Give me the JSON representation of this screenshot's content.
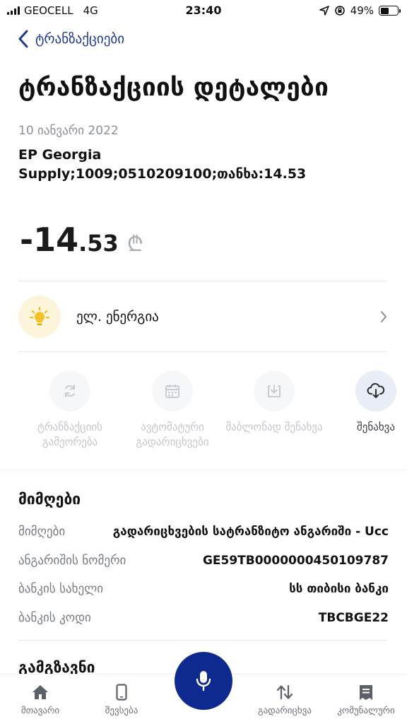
{
  "status_bar": {
    "carrier": "GEOCELL",
    "network": "4G",
    "time": "23:40",
    "battery_percent": "49%",
    "battery_level": 0.49
  },
  "nav": {
    "back_label": "ტრანზაქციები"
  },
  "page_title": "ტრანზაქციის დეტალები",
  "transaction": {
    "date": "10 იანვარი 2022",
    "merchant": "EP Georgia Supply;1009;0510209100;თანხა:14.53",
    "amount_int": "-14",
    "amount_dec": ".53",
    "currency_symbol": "₾"
  },
  "category": {
    "label": "ელ. ენერგია",
    "icon": "lightbulb-icon"
  },
  "actions": [
    {
      "label": "ტრანზაქციის გამეორება",
      "icon": "repeat-icon",
      "enabled": false
    },
    {
      "label": "ავტომატური გადარიცხვები",
      "icon": "calendar-icon",
      "enabled": false
    },
    {
      "label": "შაბლონად შენახვა",
      "icon": "download-template-icon",
      "enabled": false
    },
    {
      "label": "შენახვა",
      "icon": "cloud-download-icon",
      "enabled": true
    }
  ],
  "recipient": {
    "title": "მიმღები",
    "rows": [
      {
        "key": "მიმღები",
        "value": "გადარიცხვების სატრანზიტო ანგარიში - Ucc"
      },
      {
        "key": "ანგარიშის ნომერი",
        "value": "GE59TB0000000450109787"
      },
      {
        "key": "ბანკის სახელი",
        "value": "სს თიბისი ბანკი"
      },
      {
        "key": "ბანკის კოდი",
        "value": "TBCBGE22"
      }
    ]
  },
  "sender": {
    "title": "გამგზავნი"
  },
  "bottom_nav": [
    {
      "label": "მთავარი",
      "icon": "home-icon"
    },
    {
      "label": "შევსება",
      "icon": "phone-icon"
    },
    {
      "label": "გადარიცხვა",
      "icon": "transfer-arrows-icon"
    },
    {
      "label": "კომუნალური",
      "icon": "utility-bill-icon"
    }
  ],
  "colors": {
    "accent": "#0f2a8f",
    "link": "#1e3a8a",
    "muted": "#8b8f96",
    "category_bg": "#fdf4dc"
  }
}
